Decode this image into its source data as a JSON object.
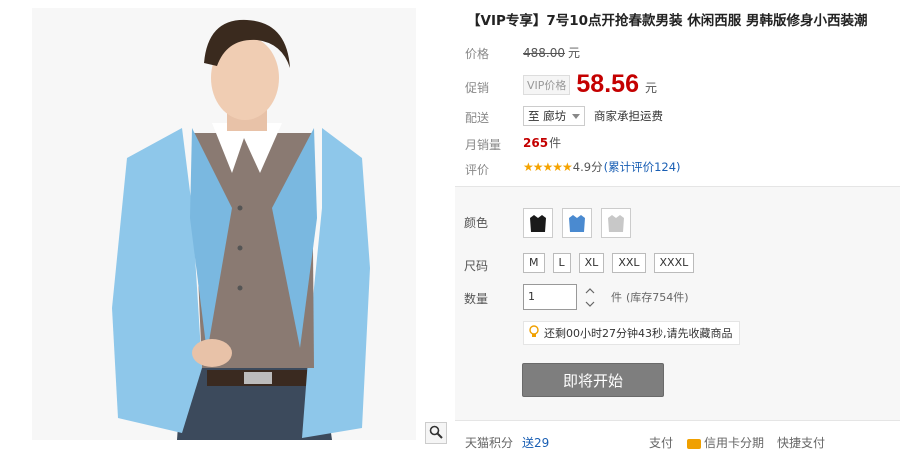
{
  "product": {
    "title": "【VIP专享】7号10点开抢春款男装 休闲西服 男韩版修身小西装潮",
    "price_label": "价格",
    "original_price": "488.00",
    "currency_unit": "元",
    "promo_label": "促销",
    "vip_tag": "VIP价格",
    "vip_price": "58.56",
    "shipping_label": "配送",
    "shipping_dest": "至 廊坊",
    "shipping_note": "商家承担运费",
    "monthly_sales_label": "月销量",
    "monthly_sales_value": "265",
    "monthly_sales_unit": "件",
    "rating_label": "评价",
    "rating_stars": "★★★★★",
    "rating_score": "4.9分",
    "rating_count_link": "(累计评价124)"
  },
  "sku": {
    "color_label": "颜色",
    "colors": [
      {
        "name": "black",
        "hex": "#1a1a1a"
      },
      {
        "name": "blue",
        "hex": "#4a8ad0"
      },
      {
        "name": "light-gray",
        "hex": "#c8c8c8"
      }
    ],
    "size_label": "尺码",
    "sizes": [
      "M",
      "L",
      "XL",
      "XXL",
      "XXXL"
    ],
    "qty_label": "数量",
    "qty_value": "1",
    "qty_unit": "件",
    "stock_text": "(库存754件)",
    "reminder_text": "还剩00小时27分钟43秒,请先收藏商品",
    "buy_button": "即将开始"
  },
  "bottom": {
    "points_label": "天猫积分",
    "points_value": "送29",
    "pay_label": "支付",
    "pay_option1": "信用卡分期",
    "pay_option2": "快捷支付"
  },
  "colors": {
    "accent_red": "#c40000",
    "link_blue": "#1a5fb4",
    "star_orange": "#f5a300"
  }
}
